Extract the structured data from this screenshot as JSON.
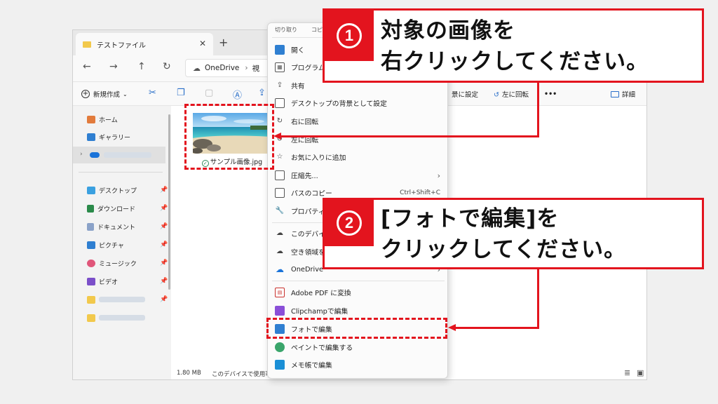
{
  "explorer": {
    "tab_title": "テストファイル",
    "tab_close": "✕",
    "new_tab": "+",
    "address": "OneDrive",
    "address_sep": "›",
    "address_next": "視",
    "new_label": "新規作成",
    "new_chevron": "⌄",
    "cmd_right": [
      "景に設定",
      "左に回転"
    ],
    "more": "•••",
    "details_label": "詳細"
  },
  "sidebar": {
    "home": "ホーム",
    "gallery": "ギャラリー",
    "desktop": "デスクトップ",
    "downloads": "ダウンロード",
    "documents": "ドキュメント",
    "pictures": "ピクチャ",
    "music": "ミュージック",
    "videos": "ビデオ",
    "pin": "📌"
  },
  "file": {
    "name": "サンプル画像.jpg",
    "check": "✓"
  },
  "status": {
    "size": "1.80 MB",
    "availability": "このデバイスで使用可"
  },
  "menu": {
    "top_partial": "切り取り",
    "top_partial2": "コピ",
    "items": [
      {
        "label": "開く",
        "shortcut": ""
      },
      {
        "label": "プログラムから開く",
        "shortcut": ""
      },
      {
        "label": "共有",
        "shortcut": ""
      },
      {
        "label": "デスクトップの背景として設定",
        "shortcut": ""
      },
      {
        "label": "右に回転",
        "shortcut": ""
      },
      {
        "label": "左に回転",
        "shortcut": ""
      },
      {
        "label": "お気に入りに追加",
        "shortcut": ""
      },
      {
        "label": "圧縮先...",
        "shortcut": "›"
      },
      {
        "label": "パスのコピー",
        "shortcut": "Ctrl+Shift+C"
      },
      {
        "label": "プロパティ",
        "shortcut": ""
      },
      {
        "label": "このデバイス上で常に保持する",
        "shortcut": ""
      },
      {
        "label": "空き領域を増やす",
        "shortcut": ""
      },
      {
        "label": "OneDrive",
        "shortcut": "›"
      },
      {
        "label": "Adobe PDF に変換",
        "shortcut": ""
      },
      {
        "label": "Clipchampで編集",
        "shortcut": ""
      },
      {
        "label": "フォトで編集",
        "shortcut": ""
      },
      {
        "label": "ペイントで編集する",
        "shortcut": ""
      },
      {
        "label": "メモ帳で編集",
        "shortcut": ""
      }
    ]
  },
  "callouts": {
    "one_num": "1",
    "one_line1": "対象の画像を",
    "one_line2": "右クリックしてください。",
    "two_num": "2",
    "two_line1": "[フォトで編集]を",
    "two_line2": "クリックしてください。"
  },
  "colors": {
    "accent_red": "#e3141e"
  }
}
